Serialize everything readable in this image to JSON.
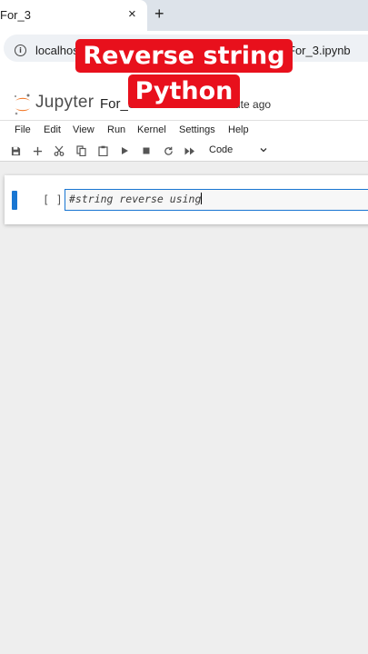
{
  "browser": {
    "tab_title": "For_3",
    "tab_close_glyph": "×",
    "new_tab_glyph": "+",
    "url_left": "localhost:8",
    "url_right": "For_3.ipynb"
  },
  "caption": {
    "line1": "Reverse string",
    "line2": "Python",
    "bg_color": "#e8101c"
  },
  "jupyter": {
    "logo_text": "Jupyter",
    "notebook_name": "For_3",
    "last_saved": "ute ago",
    "menu": [
      "File",
      "Edit",
      "View",
      "Run",
      "Kernel",
      "Settings",
      "Help"
    ],
    "toolbar_icons": [
      "save-icon",
      "add-icon",
      "cut-icon",
      "copy-icon",
      "paste-icon",
      "run-icon",
      "stop-icon",
      "restart-icon",
      "fast-forward-icon"
    ],
    "cell_type": "Code",
    "accent_color": "#1976d2"
  },
  "cell": {
    "prompt": "[ ]:",
    "code": "#string reverse using"
  }
}
